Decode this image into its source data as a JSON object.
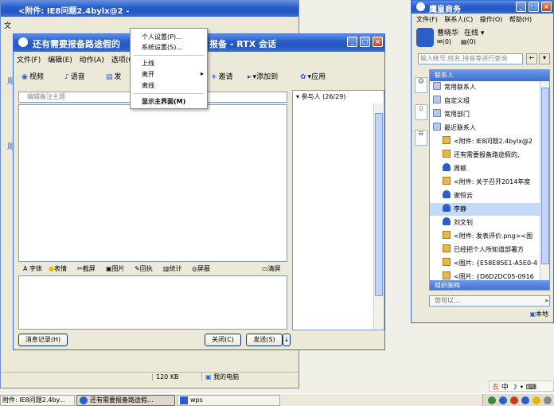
{
  "back_window": {
    "title": "<附件: IE8问题2.4bylx@2 -",
    "menu_partial": "文",
    "status": {
      "size": "120 KB",
      "location": "我的电脑"
    }
  },
  "chat_window": {
    "title": "还有需要报备路途假的",
    "title_suffix": "报备 - RTX 会话",
    "menu": [
      "文件(F)",
      "编辑(E)",
      "动作(A)",
      "选项(O)"
    ],
    "toolbar": [
      {
        "label": "视频",
        "icon": "video-icon"
      },
      {
        "label": "语音",
        "icon": "voice-icon"
      },
      {
        "label": "发",
        "icon": "send-file-icon"
      },
      {
        "label": "邀请",
        "icon": "invite-icon"
      },
      {
        "label": "添加到",
        "icon": "add-to-icon"
      },
      {
        "label": "应用",
        "icon": "apps-icon"
      }
    ],
    "memo_placeholder": "编辑备注主题",
    "format_bar": [
      "字体",
      "表情",
      "截屏",
      "图片",
      "回执",
      "统计",
      "屏蔽",
      "清屏"
    ],
    "buttons": {
      "history": "消息记录(H)",
      "close": "关闭(C)",
      "send": "发送(S)"
    },
    "participants_label": "参与人 (26/29)"
  },
  "context_menu": {
    "items": [
      "个人设置(P)...",
      "系统设置(S)...",
      "上线",
      "离开",
      "离线",
      "显示主界面(M)"
    ]
  },
  "im_window": {
    "title": "鹰皇商务",
    "menu": [
      "文件(F)",
      "联系人(C)",
      "操作(O)",
      "帮助(H)"
    ],
    "user_name": "曹晓华",
    "user_status": "在线",
    "mail_count": "(0)",
    "msg_count": "(0)",
    "search_placeholder": "输入帐号,姓名,拼音等进行查询",
    "contacts_header": "联系人",
    "org_header": "组织架构",
    "contacts": [
      {
        "label": "常用联系人",
        "type": "folder"
      },
      {
        "label": "自定义组",
        "type": "folder"
      },
      {
        "label": "常用部门",
        "type": "folder"
      },
      {
        "label": "最近联系人",
        "type": "folder"
      },
      {
        "label": "<附件: IE8问题2.4bylx@2",
        "type": "session"
      },
      {
        "label": "还有需要报备路途假的,",
        "type": "session"
      },
      {
        "label": "周颖",
        "type": "person"
      },
      {
        "label": "<附件: 关于召开2014年度",
        "type": "session"
      },
      {
        "label": "谢恒云",
        "type": "person"
      },
      {
        "label": "李静",
        "type": "person",
        "selected": true
      },
      {
        "label": "刘文钊",
        "type": "person"
      },
      {
        "label": "<附件: 发表评价.png><图",
        "type": "session"
      },
      {
        "label": "已经把个人所知道部署方",
        "type": "session"
      },
      {
        "label": "<图片: {E58E85E1-A5E0-4",
        "type": "session"
      },
      {
        "label": "<图片: {D6D2DC05-0916",
        "type": "session"
      }
    ],
    "status_input": "您可以...",
    "footer": "本地"
  },
  "langbar": {
    "mode": "中"
  },
  "taskbar": {
    "items": [
      {
        "label": "附件: IE8问题2.4by..."
      },
      {
        "label": "还有需要报备路途假...",
        "active": true
      },
      {
        "label": "wps"
      }
    ]
  }
}
